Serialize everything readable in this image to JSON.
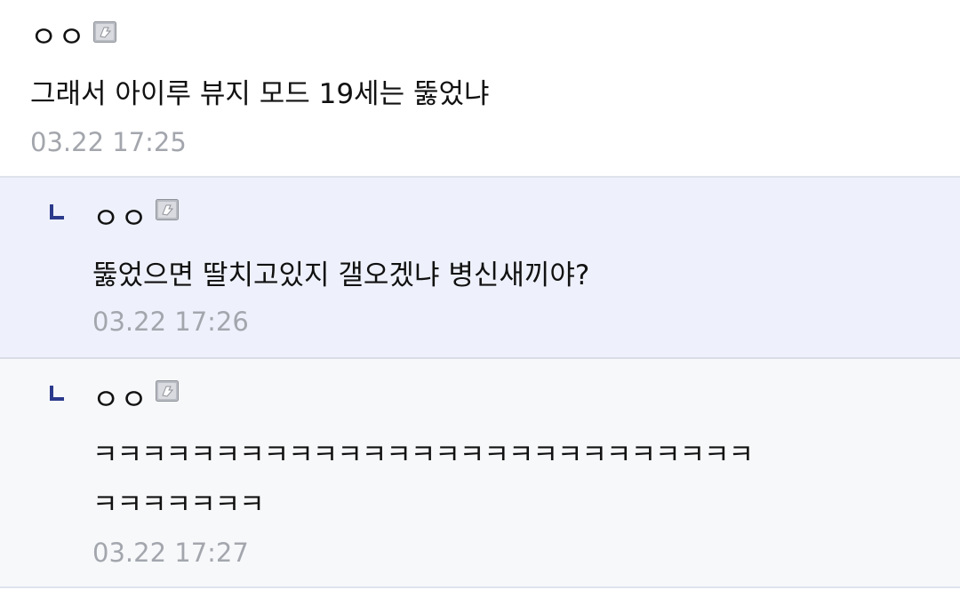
{
  "comments": [
    {
      "nickname": "ㅇㅇ",
      "text": "그래서 아이루 뷰지 모드 19세는 뚫었냐",
      "date": "03.22 17:25",
      "is_reply": false
    },
    {
      "nickname": "ㅇㅇ",
      "text": "뚫었으면 딸치고있지 갤오겠냐 병신새끼야?",
      "date": "03.22 17:26",
      "is_reply": true
    },
    {
      "nickname": "ㅇㅇ",
      "text_line1": "ㅋㅋㅋㅋㅋㅋㅋㅋㅋㅋㅋㅋㅋㅋㅋㅋㅋㅋㅋㅋㅋㅋㅋㅋㅋㅋㅋ",
      "text_line2": "ㅋㅋㅋㅋㅋㅋㅋ",
      "date": "03.22 17:27",
      "is_reply": true
    }
  ],
  "icons": {
    "fixed_nick_icon": "fixed-nickname-icon",
    "reply_icon": "reply-arrow-icon"
  },
  "colors": {
    "reply_mark": "#2b3a8c",
    "date_text": "#a3a6ad",
    "reply_bg": "#eef1fb",
    "reply_bg_alt": "#f7f8fa"
  }
}
